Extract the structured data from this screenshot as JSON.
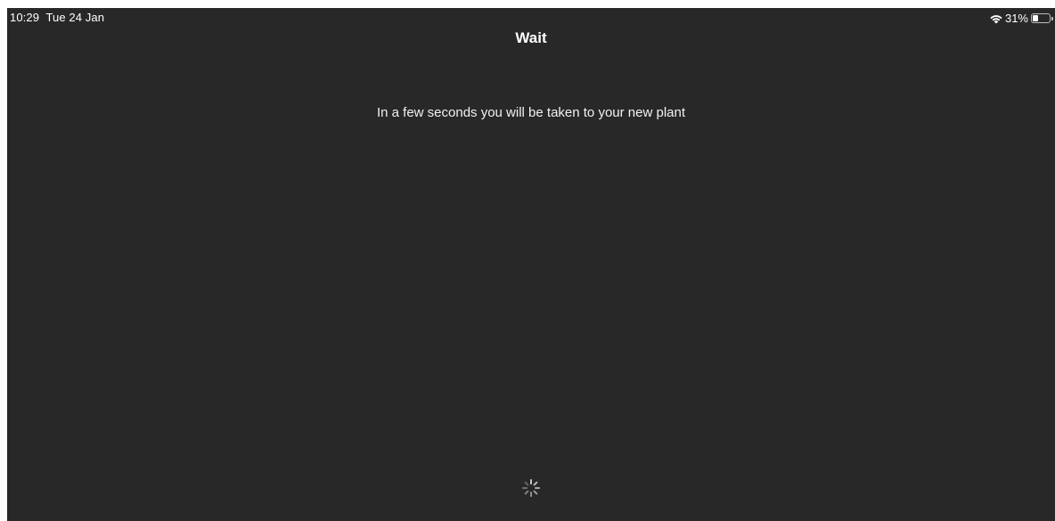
{
  "status_bar": {
    "time": "10:29",
    "date": "Tue 24 Jan",
    "battery_percent_label": "31%",
    "battery_level": 0.31,
    "wifi_icon": "wifi-icon",
    "battery_icon": "battery-icon"
  },
  "nav": {
    "title": "Wait"
  },
  "main": {
    "message": "In a few seconds you will be taken to your new plant",
    "spinner_icon": "activity-spinner-icon"
  },
  "colors": {
    "background": "#282828",
    "text": "#ffffff"
  }
}
